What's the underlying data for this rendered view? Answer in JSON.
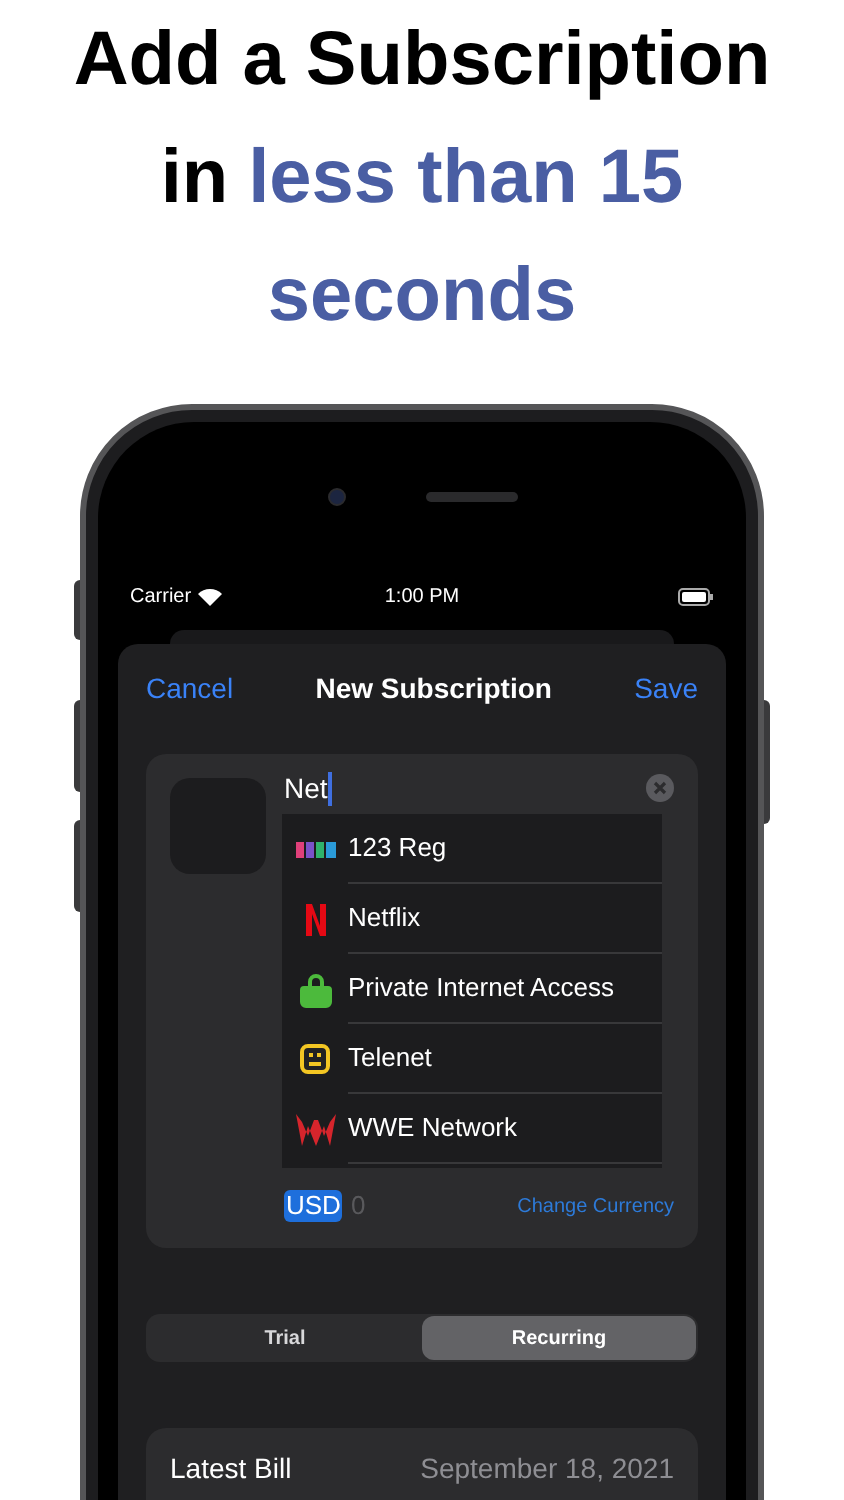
{
  "headline": [
    [
      {
        "text": "Add a Subscription",
        "highlight": false
      }
    ],
    [
      {
        "text": "in",
        "highlight": false
      },
      {
        "text": "less than 15",
        "highlight": true
      }
    ],
    [
      {
        "text": "seconds",
        "highlight": true
      }
    ]
  ],
  "status_bar": {
    "carrier": "Carrier",
    "time": "1:00 PM"
  },
  "nav": {
    "cancel": "Cancel",
    "title": "New Subscription",
    "save": "Save"
  },
  "name_field": {
    "value": "Net"
  },
  "suggestions": [
    {
      "name": "123 Reg",
      "kind": "blocks"
    },
    {
      "name": "Netflix",
      "kind": "letter-n"
    },
    {
      "name": "Private Internet Access",
      "kind": "lock"
    },
    {
      "name": "Telenet",
      "kind": "smiley"
    },
    {
      "name": "WWE Network",
      "kind": "w-mark"
    }
  ],
  "currency": {
    "code": "USD",
    "amount": "0",
    "change": "Change Currency"
  },
  "segments": [
    {
      "label": "Trial",
      "selected": false
    },
    {
      "label": "Recurring",
      "selected": true
    }
  ],
  "latest_bill": {
    "label": "Latest Bill",
    "value": "September 18, 2021"
  }
}
